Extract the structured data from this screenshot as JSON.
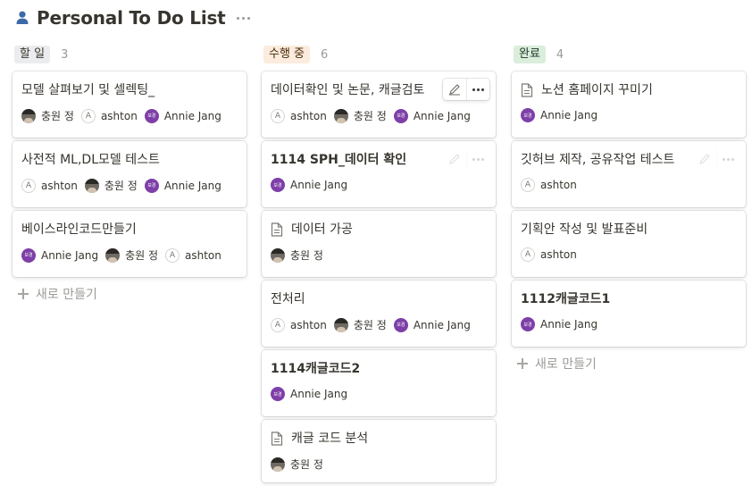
{
  "page": {
    "title": "Personal To Do List",
    "icon": "person-icon"
  },
  "board": {
    "new_label": "새로 만들기",
    "columns": [
      {
        "label": "할 일",
        "count": "3",
        "tag_bg": "#ebeced",
        "tag_color": "#37352f",
        "cards": [
          {
            "title": "모델 살펴보기 및 셀렉팅_",
            "people": [
              {
                "name": "충원 정",
                "avatar": "photo"
              },
              {
                "name": "ashton",
                "avatar": "A"
              },
              {
                "name": "Annie Jang",
                "avatar": "보경"
              }
            ]
          },
          {
            "title": "사전적 ML,DL모델 테스트",
            "people": [
              {
                "name": "ashton",
                "avatar": "A"
              },
              {
                "name": "충원 정",
                "avatar": "photo"
              },
              {
                "name": "Annie Jang",
                "avatar": "보경"
              }
            ]
          },
          {
            "title": "베이스라인코드만들기",
            "people": [
              {
                "name": "Annie Jang",
                "avatar": "보경"
              },
              {
                "name": "충원 정",
                "avatar": "photo"
              },
              {
                "name": "ashton",
                "avatar": "A"
              }
            ]
          }
        ]
      },
      {
        "label": "수행 중",
        "count": "6",
        "tag_bg": "#fbecdd",
        "tag_color": "#49290e",
        "cards": [
          {
            "title": "데이터확인 및 논문, 캐글검토",
            "people": [
              {
                "name": "ashton",
                "avatar": "A"
              },
              {
                "name": "충원 정",
                "avatar": "photo"
              },
              {
                "name": "Annie Jang",
                "avatar": "보경"
              }
            ]
          },
          {
            "title": "1114 SPH_데이터 확인",
            "people": [
              {
                "name": "Annie Jang",
                "avatar": "보경"
              }
            ]
          },
          {
            "title": "데이터 가공",
            "doc": true,
            "people": [
              {
                "name": "충원 정",
                "avatar": "photo"
              }
            ]
          },
          {
            "title": "전처리",
            "people": [
              {
                "name": "ashton",
                "avatar": "A"
              },
              {
                "name": "충원 정",
                "avatar": "photo"
              },
              {
                "name": "Annie Jang",
                "avatar": "보경"
              }
            ]
          },
          {
            "title": "1114캐글코드2",
            "people": [
              {
                "name": "Annie Jang",
                "avatar": "보경"
              }
            ]
          },
          {
            "title": "캐글 코드 분석",
            "doc": true,
            "people": [
              {
                "name": "충원 정",
                "avatar": "photo"
              }
            ]
          }
        ]
      },
      {
        "label": "완료",
        "count": "4",
        "tag_bg": "#dbeddb",
        "tag_color": "#1c3829",
        "cards": [
          {
            "title": "노션 홈페이지 꾸미기",
            "doc": true,
            "people": [
              {
                "name": "Annie Jang",
                "avatar": "보경"
              }
            ]
          },
          {
            "title": "깃허브 제작, 공유작업 테스트",
            "people": [
              {
                "name": "ashton",
                "avatar": "A"
              }
            ]
          },
          {
            "title": "기획안 작성 및 발표준비",
            "people": [
              {
                "name": "ashton",
                "avatar": "A"
              }
            ]
          },
          {
            "title": "1112캐글코드1",
            "people": [
              {
                "name": "Annie Jang",
                "avatar": "보경"
              }
            ]
          }
        ]
      }
    ]
  }
}
